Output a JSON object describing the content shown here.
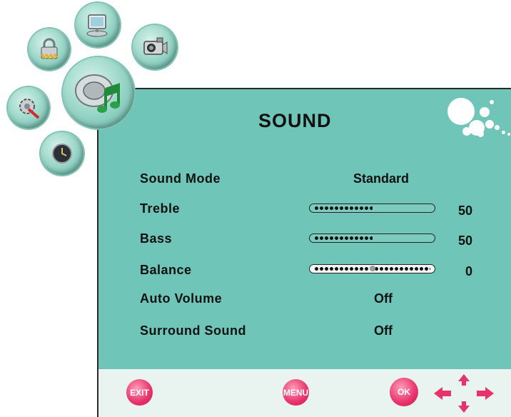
{
  "menu": {
    "title": "SOUND",
    "items": [
      {
        "label": "Sound Mode",
        "value": "Standard"
      },
      {
        "label": "Treble",
        "value": "50",
        "level": 0.5
      },
      {
        "label": "Bass",
        "value": "50",
        "level": 0.5
      },
      {
        "label": "Balance",
        "value": "0",
        "level": 0.5
      },
      {
        "label": "Auto Volume",
        "value": "Off"
      },
      {
        "label": "Surround Sound",
        "value": "Off"
      }
    ]
  },
  "icons": [
    "lock-icon",
    "computer-icon",
    "camera-icon",
    "music-note-icon",
    "tools-icon",
    "clock-icon"
  ],
  "buttons": {
    "exit": "EXIT",
    "menu": "MENU",
    "ok": "OK"
  },
  "colors": {
    "panel": "#6fc5b8",
    "button": "#e8326b",
    "bottom_bar": "#e9f3f0"
  }
}
